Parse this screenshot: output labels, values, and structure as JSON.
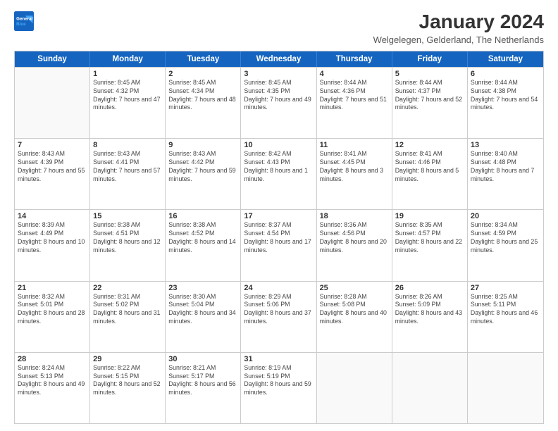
{
  "logo": {
    "line1": "General",
    "line2": "Blue"
  },
  "title": "January 2024",
  "subtitle": "Welgelegen, Gelderland, The Netherlands",
  "header_days": [
    "Sunday",
    "Monday",
    "Tuesday",
    "Wednesday",
    "Thursday",
    "Friday",
    "Saturday"
  ],
  "weeks": [
    [
      {
        "day": "",
        "sunrise": "",
        "sunset": "",
        "daylight": ""
      },
      {
        "day": "1",
        "sunrise": "Sunrise: 8:45 AM",
        "sunset": "Sunset: 4:32 PM",
        "daylight": "Daylight: 7 hours and 47 minutes."
      },
      {
        "day": "2",
        "sunrise": "Sunrise: 8:45 AM",
        "sunset": "Sunset: 4:34 PM",
        "daylight": "Daylight: 7 hours and 48 minutes."
      },
      {
        "day": "3",
        "sunrise": "Sunrise: 8:45 AM",
        "sunset": "Sunset: 4:35 PM",
        "daylight": "Daylight: 7 hours and 49 minutes."
      },
      {
        "day": "4",
        "sunrise": "Sunrise: 8:44 AM",
        "sunset": "Sunset: 4:36 PM",
        "daylight": "Daylight: 7 hours and 51 minutes."
      },
      {
        "day": "5",
        "sunrise": "Sunrise: 8:44 AM",
        "sunset": "Sunset: 4:37 PM",
        "daylight": "Daylight: 7 hours and 52 minutes."
      },
      {
        "day": "6",
        "sunrise": "Sunrise: 8:44 AM",
        "sunset": "Sunset: 4:38 PM",
        "daylight": "Daylight: 7 hours and 54 minutes."
      }
    ],
    [
      {
        "day": "7",
        "sunrise": "Sunrise: 8:43 AM",
        "sunset": "Sunset: 4:39 PM",
        "daylight": "Daylight: 7 hours and 55 minutes."
      },
      {
        "day": "8",
        "sunrise": "Sunrise: 8:43 AM",
        "sunset": "Sunset: 4:41 PM",
        "daylight": "Daylight: 7 hours and 57 minutes."
      },
      {
        "day": "9",
        "sunrise": "Sunrise: 8:43 AM",
        "sunset": "Sunset: 4:42 PM",
        "daylight": "Daylight: 7 hours and 59 minutes."
      },
      {
        "day": "10",
        "sunrise": "Sunrise: 8:42 AM",
        "sunset": "Sunset: 4:43 PM",
        "daylight": "Daylight: 8 hours and 1 minute."
      },
      {
        "day": "11",
        "sunrise": "Sunrise: 8:41 AM",
        "sunset": "Sunset: 4:45 PM",
        "daylight": "Daylight: 8 hours and 3 minutes."
      },
      {
        "day": "12",
        "sunrise": "Sunrise: 8:41 AM",
        "sunset": "Sunset: 4:46 PM",
        "daylight": "Daylight: 8 hours and 5 minutes."
      },
      {
        "day": "13",
        "sunrise": "Sunrise: 8:40 AM",
        "sunset": "Sunset: 4:48 PM",
        "daylight": "Daylight: 8 hours and 7 minutes."
      }
    ],
    [
      {
        "day": "14",
        "sunrise": "Sunrise: 8:39 AM",
        "sunset": "Sunset: 4:49 PM",
        "daylight": "Daylight: 8 hours and 10 minutes."
      },
      {
        "day": "15",
        "sunrise": "Sunrise: 8:38 AM",
        "sunset": "Sunset: 4:51 PM",
        "daylight": "Daylight: 8 hours and 12 minutes."
      },
      {
        "day": "16",
        "sunrise": "Sunrise: 8:38 AM",
        "sunset": "Sunset: 4:52 PM",
        "daylight": "Daylight: 8 hours and 14 minutes."
      },
      {
        "day": "17",
        "sunrise": "Sunrise: 8:37 AM",
        "sunset": "Sunset: 4:54 PM",
        "daylight": "Daylight: 8 hours and 17 minutes."
      },
      {
        "day": "18",
        "sunrise": "Sunrise: 8:36 AM",
        "sunset": "Sunset: 4:56 PM",
        "daylight": "Daylight: 8 hours and 20 minutes."
      },
      {
        "day": "19",
        "sunrise": "Sunrise: 8:35 AM",
        "sunset": "Sunset: 4:57 PM",
        "daylight": "Daylight: 8 hours and 22 minutes."
      },
      {
        "day": "20",
        "sunrise": "Sunrise: 8:34 AM",
        "sunset": "Sunset: 4:59 PM",
        "daylight": "Daylight: 8 hours and 25 minutes."
      }
    ],
    [
      {
        "day": "21",
        "sunrise": "Sunrise: 8:32 AM",
        "sunset": "Sunset: 5:01 PM",
        "daylight": "Daylight: 8 hours and 28 minutes."
      },
      {
        "day": "22",
        "sunrise": "Sunrise: 8:31 AM",
        "sunset": "Sunset: 5:02 PM",
        "daylight": "Daylight: 8 hours and 31 minutes."
      },
      {
        "day": "23",
        "sunrise": "Sunrise: 8:30 AM",
        "sunset": "Sunset: 5:04 PM",
        "daylight": "Daylight: 8 hours and 34 minutes."
      },
      {
        "day": "24",
        "sunrise": "Sunrise: 8:29 AM",
        "sunset": "Sunset: 5:06 PM",
        "daylight": "Daylight: 8 hours and 37 minutes."
      },
      {
        "day": "25",
        "sunrise": "Sunrise: 8:28 AM",
        "sunset": "Sunset: 5:08 PM",
        "daylight": "Daylight: 8 hours and 40 minutes."
      },
      {
        "day": "26",
        "sunrise": "Sunrise: 8:26 AM",
        "sunset": "Sunset: 5:09 PM",
        "daylight": "Daylight: 8 hours and 43 minutes."
      },
      {
        "day": "27",
        "sunrise": "Sunrise: 8:25 AM",
        "sunset": "Sunset: 5:11 PM",
        "daylight": "Daylight: 8 hours and 46 minutes."
      }
    ],
    [
      {
        "day": "28",
        "sunrise": "Sunrise: 8:24 AM",
        "sunset": "Sunset: 5:13 PM",
        "daylight": "Daylight: 8 hours and 49 minutes."
      },
      {
        "day": "29",
        "sunrise": "Sunrise: 8:22 AM",
        "sunset": "Sunset: 5:15 PM",
        "daylight": "Daylight: 8 hours and 52 minutes."
      },
      {
        "day": "30",
        "sunrise": "Sunrise: 8:21 AM",
        "sunset": "Sunset: 5:17 PM",
        "daylight": "Daylight: 8 hours and 56 minutes."
      },
      {
        "day": "31",
        "sunrise": "Sunrise: 8:19 AM",
        "sunset": "Sunset: 5:19 PM",
        "daylight": "Daylight: 8 hours and 59 minutes."
      },
      {
        "day": "",
        "sunrise": "",
        "sunset": "",
        "daylight": ""
      },
      {
        "day": "",
        "sunrise": "",
        "sunset": "",
        "daylight": ""
      },
      {
        "day": "",
        "sunrise": "",
        "sunset": "",
        "daylight": ""
      }
    ]
  ]
}
